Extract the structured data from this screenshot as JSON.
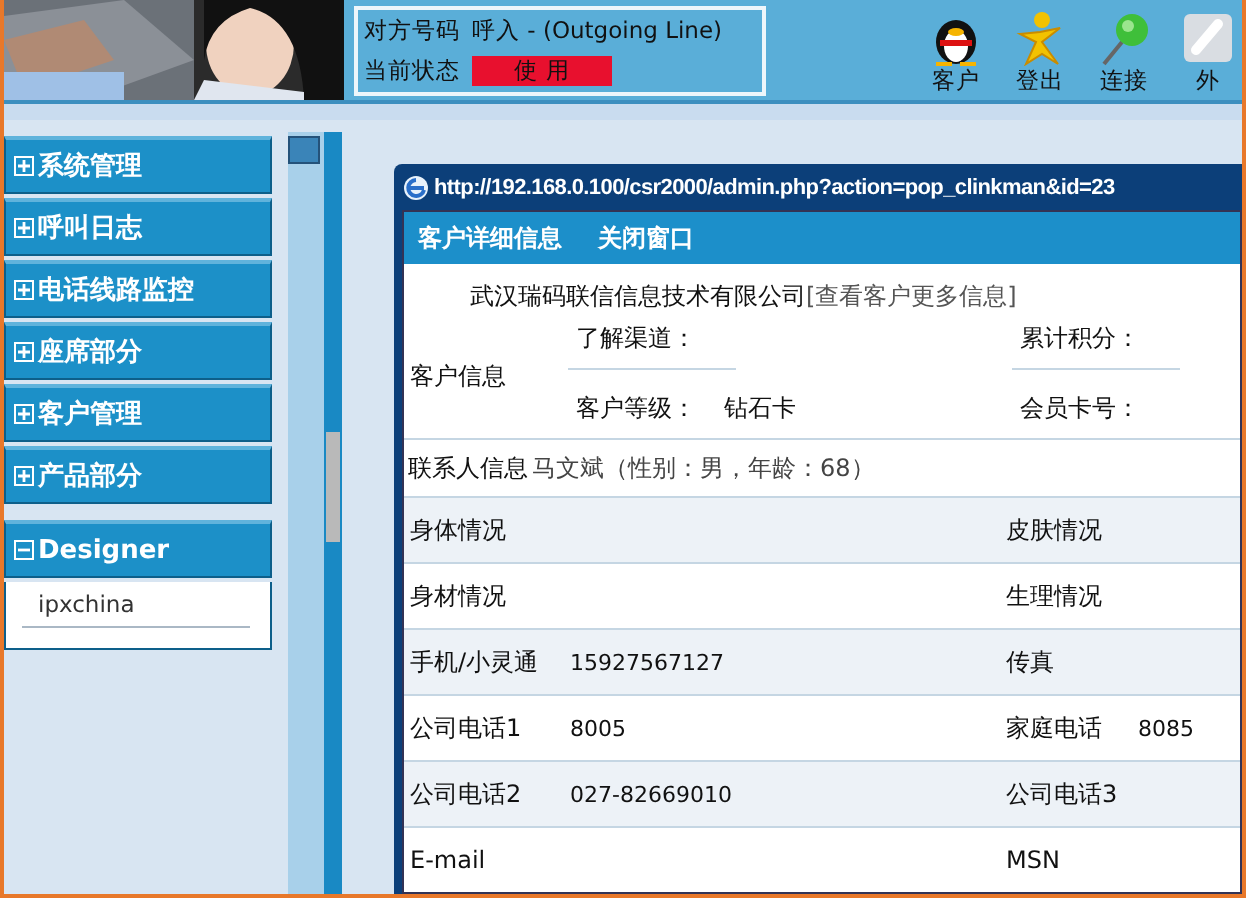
{
  "header": {
    "info_box": {
      "rows": [
        {
          "label": "对方号码",
          "kind": "text",
          "value": "呼入  - (Outgoing Line)"
        },
        {
          "label": "当前状态",
          "kind": "status",
          "value": "使 用"
        }
      ]
    },
    "toolbar": [
      {
        "label": "客户"
      },
      {
        "label": "登出"
      },
      {
        "label": "连接"
      },
      {
        "label": "外"
      }
    ]
  },
  "sidebar": {
    "items": [
      {
        "label": "系统管理",
        "expanded": false
      },
      {
        "label": "呼叫日志",
        "expanded": false
      },
      {
        "label": "电话线路监控",
        "expanded": false
      },
      {
        "label": "座席部分",
        "expanded": false
      },
      {
        "label": "客户管理",
        "expanded": false
      },
      {
        "label": "产品部分",
        "expanded": false
      },
      {
        "label": "Designer",
        "expanded": true,
        "children": [
          {
            "label": "ipxchina"
          }
        ]
      }
    ]
  },
  "popup": {
    "title": "http://192.168.0.100/csr2000/admin.php?action=pop_clinkman&id=23",
    "menu": [
      "客户详细信息",
      "关闭窗口"
    ],
    "company": "武汉瑞码联信信息技术有限公司",
    "more_link": "[查看客户更多信息]",
    "customer_info": {
      "heading": "客户信息",
      "fields": [
        {
          "label": "了解渠道："
        },
        {
          "label": "累计积分："
        },
        {
          "label": "客户等级：",
          "value": "钻石卡"
        },
        {
          "label": "会员卡号："
        }
      ]
    },
    "contact": {
      "label": "联系人信息",
      "value": "马文斌（性别：男，年龄：68）"
    },
    "rows": [
      {
        "label": "身体情况",
        "label2": "皮肤情况"
      },
      {
        "label": "身材情况",
        "label2": "生理情况"
      },
      {
        "label": "手机/小灵通",
        "value": "15927567127",
        "label2": "传真"
      },
      {
        "label": "公司电话1",
        "value": "8005",
        "label2": "家庭电话",
        "value2": "8085"
      },
      {
        "label": "公司电话2",
        "value": "027-82669010",
        "label2": "公司电话3"
      },
      {
        "label": "E-mail",
        "label2": "MSN"
      }
    ]
  }
}
